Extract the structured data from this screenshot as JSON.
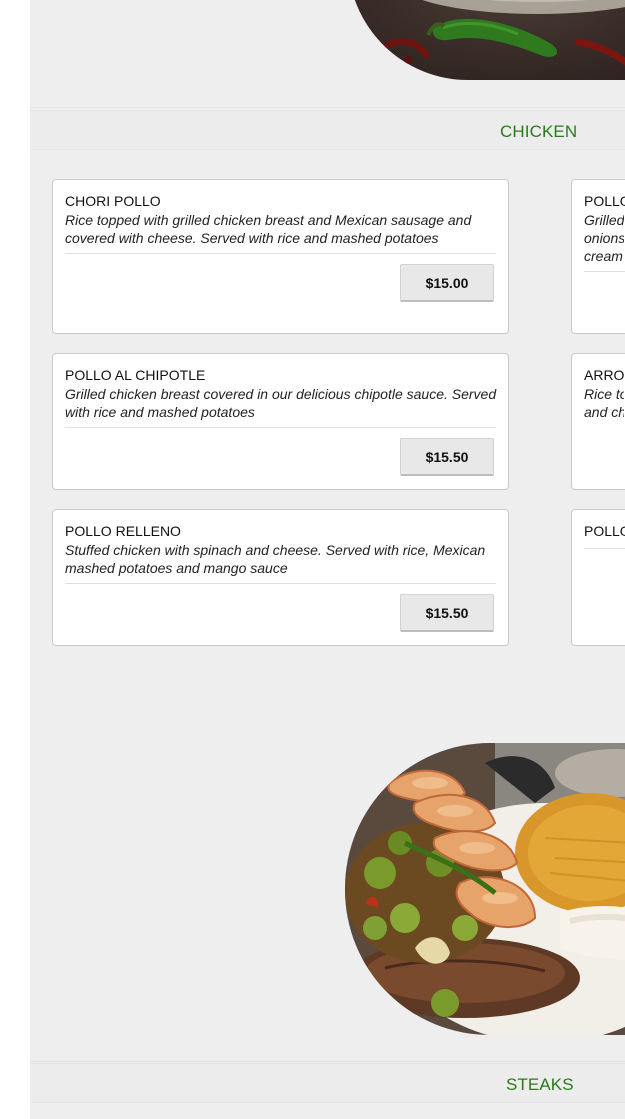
{
  "sections": {
    "chicken_title": "CHICKEN",
    "steaks_title": "STEAKS"
  },
  "left_items": [
    {
      "name": "CHORI POLLO",
      "description": "Rice topped with grilled chicken breast and Mexican sausage and covered with cheese. Served with rice and mashed potatoes",
      "price": "$15.00"
    },
    {
      "name": "POLLO AL CHIPOTLE",
      "description": "Grilled chicken breast covered in our delicious chipotle sauce. Served with rice and mashed potatoes",
      "price": "$15.50"
    },
    {
      "name": "POLLO RELLENO",
      "description": "Stuffed chicken with spinach and cheese. Served with rice, Mexican mashed potatoes and mango sauce",
      "price": "$15.50"
    }
  ],
  "right_items": [
    {
      "name": "POLLO",
      "description_lines": [
        "Grilled",
        "onions",
        "cream"
      ]
    },
    {
      "name": "ARRO",
      "description_lines": [
        "Rice to",
        "and ch"
      ]
    },
    {
      "name": "POLLO",
      "description_lines": []
    }
  ],
  "images": {
    "top_dish": "dish-with-peppers-image",
    "shrimp_dish": "shrimp-steak-rice-image"
  }
}
